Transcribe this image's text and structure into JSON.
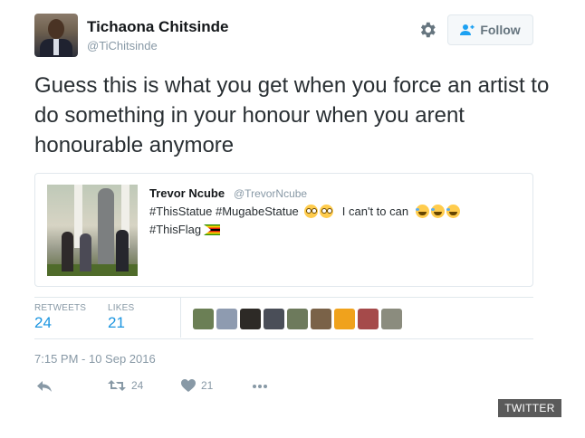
{
  "author": {
    "name": "Tichaona Chitsinde",
    "handle": "@TiChitsinde"
  },
  "header": {
    "settings_icon": "gear-icon",
    "follow_label": "Follow",
    "follow_icon": "add-user-icon"
  },
  "tweet": {
    "text": "Guess this is what you get when you force an artist to do something in your honour when you arent honourable anymore"
  },
  "quoted_tweet": {
    "author_name": "Trevor Ncube",
    "author_handle": "@TrevorNcube",
    "text_part1": "#ThisStatue #MugabeStatue",
    "text_part2": "I can't to can",
    "text_part3": "#ThisFlag",
    "emojis_after_part1": [
      "flushed-face",
      "flushed-face"
    ],
    "emojis_after_part2": [
      "tears-of-joy",
      "tears-of-joy",
      "tears-of-joy"
    ],
    "emoji_after_part3": "zimbabwe-flag"
  },
  "stats": {
    "retweets_label": "RETWEETS",
    "retweets_value": "24",
    "likes_label": "LIKES",
    "likes_value": "21",
    "liker_avatar_colors": [
      "#6b7f55",
      "#8e9bb0",
      "#2d2a26",
      "#4a4e58",
      "#6d7a5c",
      "#7a6248",
      "#f0a21c",
      "#a54a4a",
      "#8b8c7e"
    ]
  },
  "timestamp": "7:15 PM - 10 Sep 2016",
  "actions": {
    "reply_icon": "reply-icon",
    "retweet_icon": "retweet-icon",
    "retweet_count": "24",
    "like_icon": "heart-icon",
    "like_count": "21",
    "more_icon": "more-icon"
  },
  "source_badge": "TWITTER",
  "colors": {
    "accent": "#1b95e0",
    "muted": "#8899a6",
    "border": "#e1e8ed"
  }
}
